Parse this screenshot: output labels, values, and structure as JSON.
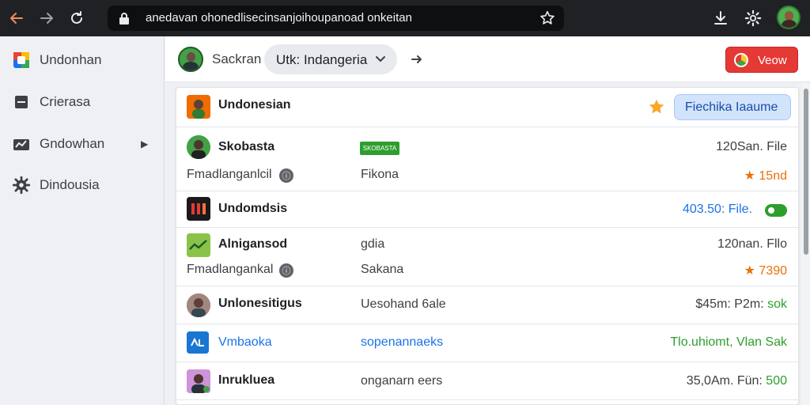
{
  "browser": {
    "url": "anedavan ohonedlisecinsanjoihoupanoad onkeitan"
  },
  "sidebar": {
    "items": [
      {
        "label": "Undonhan",
        "icon": "app-logo-icon"
      },
      {
        "label": "Crierasa",
        "icon": "document-icon"
      },
      {
        "label": "Gndowhan",
        "icon": "chart-icon"
      },
      {
        "label": "Dindousia",
        "icon": "gear-icon"
      }
    ]
  },
  "topbar": {
    "label": "Sackran",
    "select_value": "Utk: Indangeria",
    "view_button": "Veow"
  },
  "list": {
    "header_title": "Undonesian",
    "header_button": "Fiechika Iaaume",
    "rows": [
      {
        "title": "Skobasta",
        "tag": "SKOBASTA",
        "right": "120San. File",
        "sub": "Fmadlanganlcil",
        "mid": "Fikona",
        "right2": "★ 15nd"
      },
      {
        "title": "Undomdsis",
        "right": "403.50: File."
      },
      {
        "title": "Alnigansod",
        "mid": "gdia",
        "right": "120nan. Fllo",
        "sub": "Fmadlangankal",
        "mid2": "Sakana",
        "right2": "★ 7390"
      },
      {
        "title": "Unlonesitigus",
        "mid": "Uesohand 6ale",
        "right_a": "$45m: P2m:",
        "right_b": "sok"
      },
      {
        "title": "Vmbaoka",
        "mid": "sopenannaeks",
        "right": "Tlo.uhiomt, Vlan Sak"
      },
      {
        "title": "Inrukluea",
        "mid": "onganarn eers",
        "right_a": "35,0Am. Fün:",
        "right_b": "500"
      }
    ]
  },
  "colors": {
    "accent_blue": "#1a73e8",
    "accent_green": "#2e9e2e",
    "accent_orange": "#e8710a",
    "view_red": "#e53935"
  }
}
